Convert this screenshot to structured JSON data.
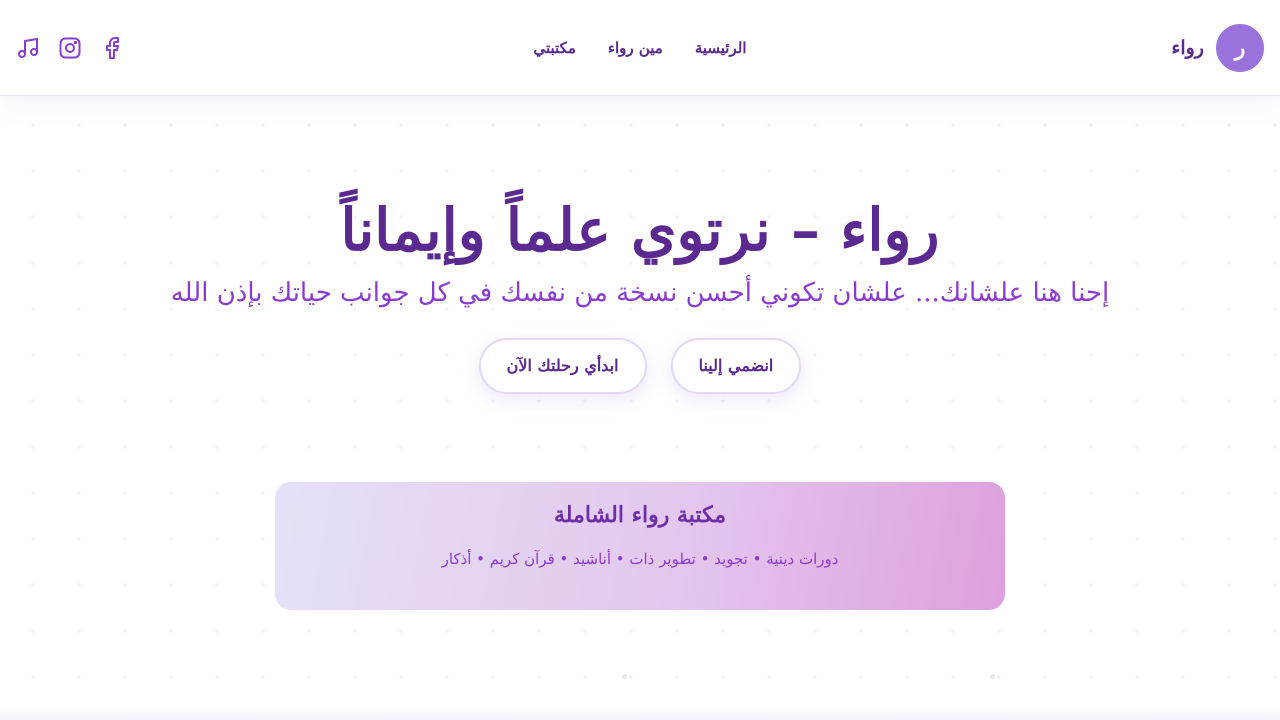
{
  "brand": {
    "initial": "ر",
    "name": "رواء"
  },
  "nav": {
    "items": [
      {
        "label": "الرئيسية"
      },
      {
        "label": "مين رواء"
      },
      {
        "label": "مكتبتي"
      }
    ]
  },
  "social": {
    "icons": [
      "facebook-icon",
      "instagram-icon",
      "music-icon"
    ]
  },
  "hero": {
    "title": "رواء – نرتوي علماً وإيماناً",
    "subtitle": "إحنا هنا علشانك... علشان تكوني أحسن نسخة من نفسك في كل جوانب حياتك بإذن الله",
    "buttons": {
      "join": "انضمي إلينا",
      "start": "ابدأي رحلتك الآن"
    }
  },
  "library": {
    "title": "مكتبة رواء الشاملة",
    "tags": "دورات دينية • تجويد • تطوير ذات • أناشيد • قرآن كريم • أذكار"
  },
  "colors": {
    "primary": "#5a2a91",
    "accent": "#8a3ccf",
    "avatar": "#9a72dc"
  }
}
